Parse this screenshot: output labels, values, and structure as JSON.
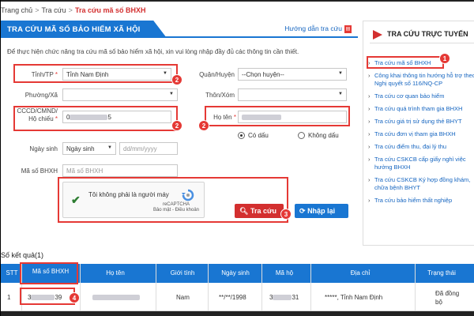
{
  "breadcrumb": {
    "items": [
      "Trang chủ",
      "Tra cứu"
    ],
    "current": "Tra cứu mã số BHXH"
  },
  "main": {
    "title": "TRA CỨU MÃ SỐ BẢO HIỂM XÃ HỘI",
    "guide_link": "Hướng dẫn tra cứu",
    "notice": "Để thực hiện chức năng tra cứu mã số bảo hiểm xã hội, xin vui lòng nhập đầy đủ các thông tin cần thiết."
  },
  "form": {
    "province_label": "Tỉnh/TP",
    "province_value": "Tỉnh Nam Định",
    "district_label": "Quận/Huyện",
    "district_value": "--Chọn huyện--",
    "ward_label": "Phường/Xã",
    "village_label": "Thôn/Xóm",
    "id_label": "CCCD/CMND/ Hộ chiếu",
    "id_value_start": "0",
    "id_value_end": "5",
    "name_label": "Họ tên",
    "accent_yes": "Có dấu",
    "accent_no": "Không dấu",
    "dob_label": "Ngày sinh",
    "dob_select": "Ngày sinh",
    "dob_placeholder": "dd/mm/yyyy",
    "bhxh_label": "Mã số BHXH",
    "bhxh_placeholder": "Mã số BHXH"
  },
  "captcha": {
    "text": "Tôi không phải là người máy",
    "brand": "reCAPTCHA",
    "terms": "Bảo mật - Điều khoản"
  },
  "buttons": {
    "search": "Tra cứu",
    "reset": "Nhập lại"
  },
  "sidebar": {
    "title": "TRA CỨU TRỰC TUYẾN",
    "items": [
      "Tra cứu mã số BHXH",
      "Công khai thông tin hướng hỗ trợ theo Nghị quyết số 116/NQ-CP",
      "Tra cứu cơ quan bảo hiểm",
      "Tra cứu quá trình tham gia BHXH",
      "Tra cứu giá trị sử dụng thẻ BHYT",
      "Tra cứu đơn vị tham gia BHXH",
      "Tra cứu điểm thu, đại lý thu",
      "Tra cứu CSKCB cấp giấy nghỉ việc hưởng BHXH",
      "Tra cứu CSKCB Ký hợp đồng khám, chữa bệnh BHYT",
      "Tra cứu bảo hiểm thất nghiệp"
    ]
  },
  "results": {
    "label": "Số kết quả(1)",
    "columns": [
      "STT",
      "Mã số BHXH",
      "Họ tên",
      "Giới tính",
      "Ngày sinh",
      "Mã hộ",
      "Địa chỉ",
      "Trạng thái"
    ],
    "row": {
      "stt": "1",
      "bhxh_start": "3",
      "bhxh_end": "39",
      "gender": "Nam",
      "dob": "**/**/1998",
      "household_start": "3",
      "household_end": "31",
      "address": "*****, Tỉnh Nam Định",
      "status": "Đã đồng bộ"
    }
  },
  "annotations": [
    "1",
    "2",
    "2",
    "2",
    "3",
    "4"
  ],
  "colors": {
    "primary": "#1976d2",
    "danger": "#d32f2f",
    "highlight": "#e53935"
  }
}
